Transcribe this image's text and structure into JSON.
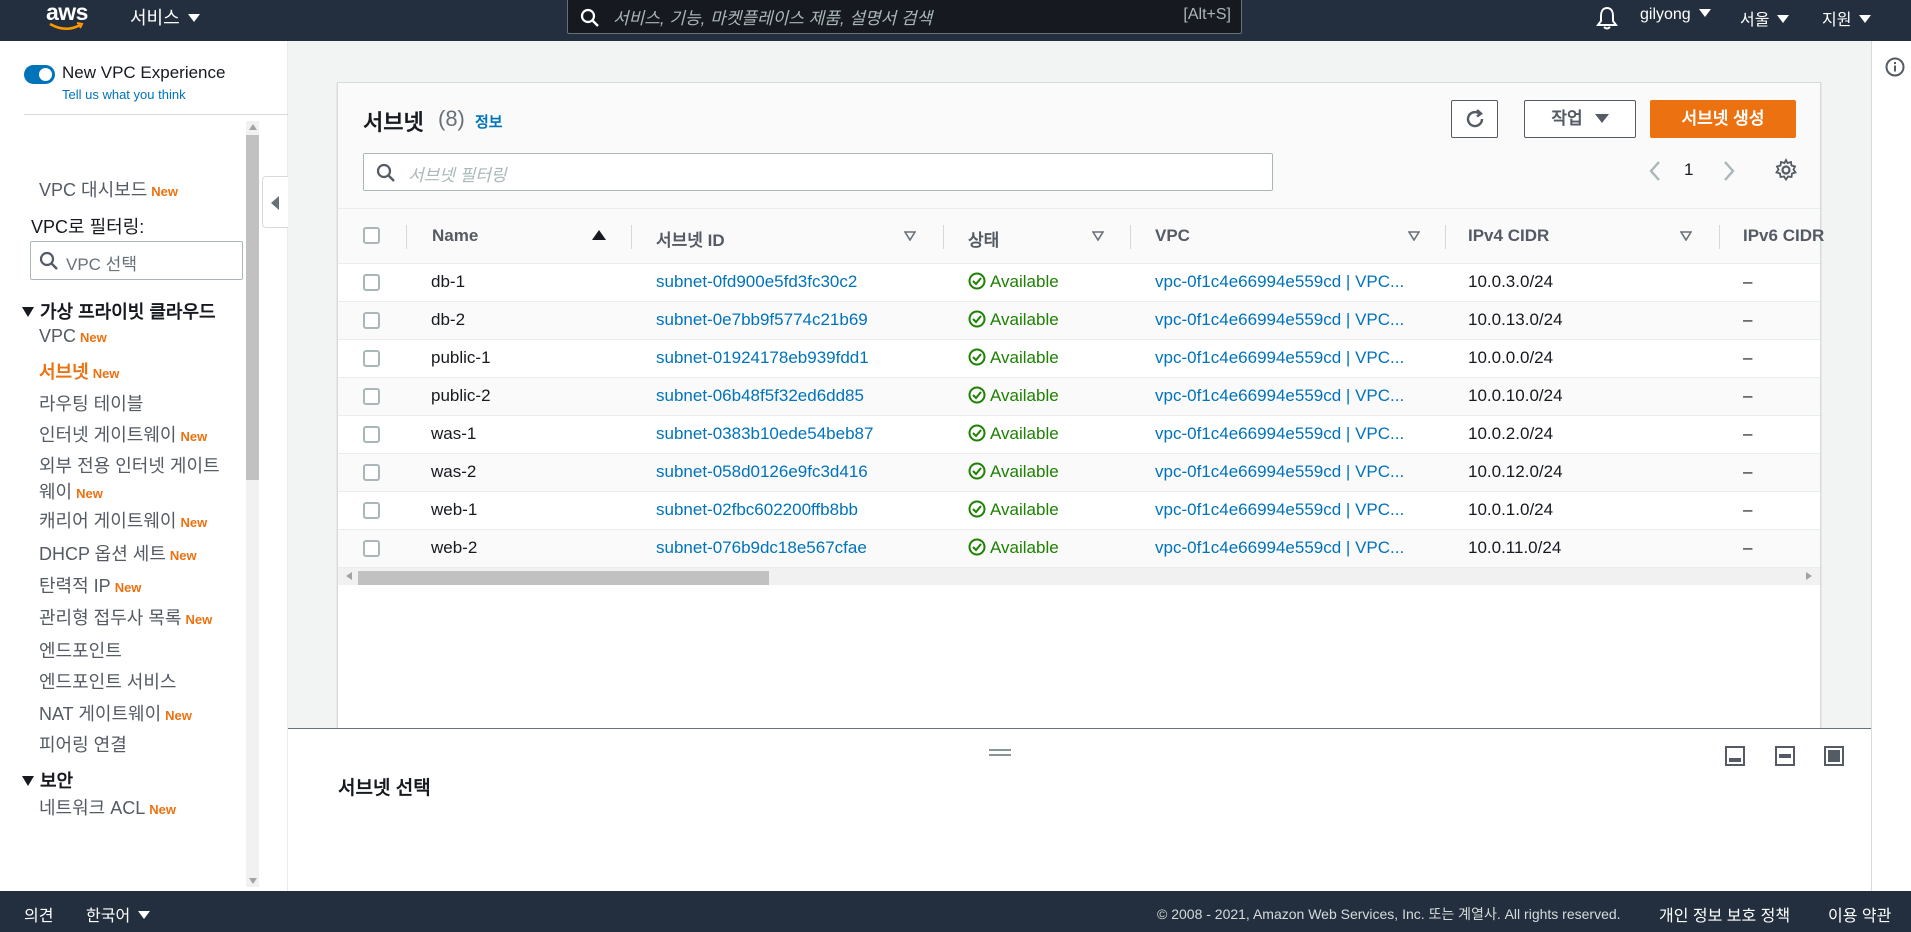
{
  "topnav": {
    "logo_text": "aws",
    "services_label": "서비스",
    "search_placeholder": "서비스, 기능, 마켓플레이스 제품, 설명서 검색",
    "search_shortcut": "[Alt+S]",
    "user_label": "gilyong",
    "region_label": "서울",
    "support_label": "지원"
  },
  "sidebar": {
    "toggle_label": "New VPC Experience",
    "toggle_sub": "Tell us what you think",
    "dashboard": {
      "label": "VPC 대시보드",
      "badge": "New"
    },
    "filter_label": "VPC로 필터링:",
    "filter_placeholder": "VPC 선택",
    "section_private_cloud": "가상 프라이빗 클라우드",
    "items": [
      {
        "label": "VPC",
        "badge": "New"
      },
      {
        "label": "서브넷",
        "badge": "New"
      },
      {
        "label": "라우팅 테이블",
        "badge": ""
      },
      {
        "label": "인터넷 게이트웨이",
        "badge": "New"
      },
      {
        "label": "외부 전용 인터넷 게이트",
        "label2": "웨이",
        "badge": "New"
      },
      {
        "label": "캐리어 게이트웨이",
        "badge": "New"
      },
      {
        "label": "DHCP 옵션 세트",
        "badge": "New"
      },
      {
        "label": "탄력적 IP",
        "badge": "New"
      },
      {
        "label": "관리형 접두사 목록",
        "badge": "New"
      },
      {
        "label": "엔드포인트",
        "badge": ""
      },
      {
        "label": "엔드포인트 서비스",
        "badge": ""
      },
      {
        "label": "NAT 게이트웨이",
        "badge": "New"
      },
      {
        "label": "피어링 연결",
        "badge": ""
      }
    ],
    "section_security": "보안",
    "security_items": [
      {
        "label": "네트워크 ACL",
        "badge": "New"
      }
    ]
  },
  "panel": {
    "title": "서브넷",
    "count": "(8)",
    "info_link": "정보",
    "actions_label": "작업",
    "create_label": "서브넷 생성",
    "filter_placeholder": "서브넷 필터링",
    "page_number": "1",
    "columns": [
      "Name",
      "서브넷 ID",
      "상태",
      "VPC",
      "IPv4 CIDR",
      "IPv6 CIDR"
    ],
    "rows": [
      {
        "name": "db-1",
        "subnet_id": "subnet-0fd900e5fd3fc30c2",
        "state": "Available",
        "vpc": "vpc-0f1c4e66994e559cd | VPC...",
        "ipv4": "10.0.3.0/24",
        "ipv6": "–"
      },
      {
        "name": "db-2",
        "subnet_id": "subnet-0e7bb9f5774c21b69",
        "state": "Available",
        "vpc": "vpc-0f1c4e66994e559cd | VPC...",
        "ipv4": "10.0.13.0/24",
        "ipv6": "–"
      },
      {
        "name": "public-1",
        "subnet_id": "subnet-01924178eb939fdd1",
        "state": "Available",
        "vpc": "vpc-0f1c4e66994e559cd | VPC...",
        "ipv4": "10.0.0.0/24",
        "ipv6": "–"
      },
      {
        "name": "public-2",
        "subnet_id": "subnet-06b48f5f32ed6dd85",
        "state": "Available",
        "vpc": "vpc-0f1c4e66994e559cd | VPC...",
        "ipv4": "10.0.10.0/24",
        "ipv6": "–"
      },
      {
        "name": "was-1",
        "subnet_id": "subnet-0383b10ede54beb87",
        "state": "Available",
        "vpc": "vpc-0f1c4e66994e559cd | VPC...",
        "ipv4": "10.0.2.0/24",
        "ipv6": "–"
      },
      {
        "name": "was-2",
        "subnet_id": "subnet-058d0126e9fc3d416",
        "state": "Available",
        "vpc": "vpc-0f1c4e66994e559cd | VPC...",
        "ipv4": "10.0.12.0/24",
        "ipv6": "–"
      },
      {
        "name": "web-1",
        "subnet_id": "subnet-02fbc602200ffb8bb",
        "state": "Available",
        "vpc": "vpc-0f1c4e66994e559cd | VPC...",
        "ipv4": "10.0.1.0/24",
        "ipv6": "–"
      },
      {
        "name": "web-2",
        "subnet_id": "subnet-076b9dc18e567cfae",
        "state": "Available",
        "vpc": "vpc-0f1c4e66994e559cd | VPC...",
        "ipv4": "10.0.11.0/24",
        "ipv6": "–"
      }
    ]
  },
  "split_panel": {
    "title": "서브넷 선택"
  },
  "footer": {
    "feedback": "의견",
    "language": "한국어",
    "copyright": "© 2008 - 2021, Amazon Web Services, Inc. 또는 계열사. All rights reserved.",
    "privacy": "개인 정보 보호 정책",
    "terms": "이용 약관"
  },
  "colors": {
    "nav_bg": "#232f3e",
    "accent": "#ec7211",
    "link": "#0073bb",
    "success": "#1d8102"
  }
}
